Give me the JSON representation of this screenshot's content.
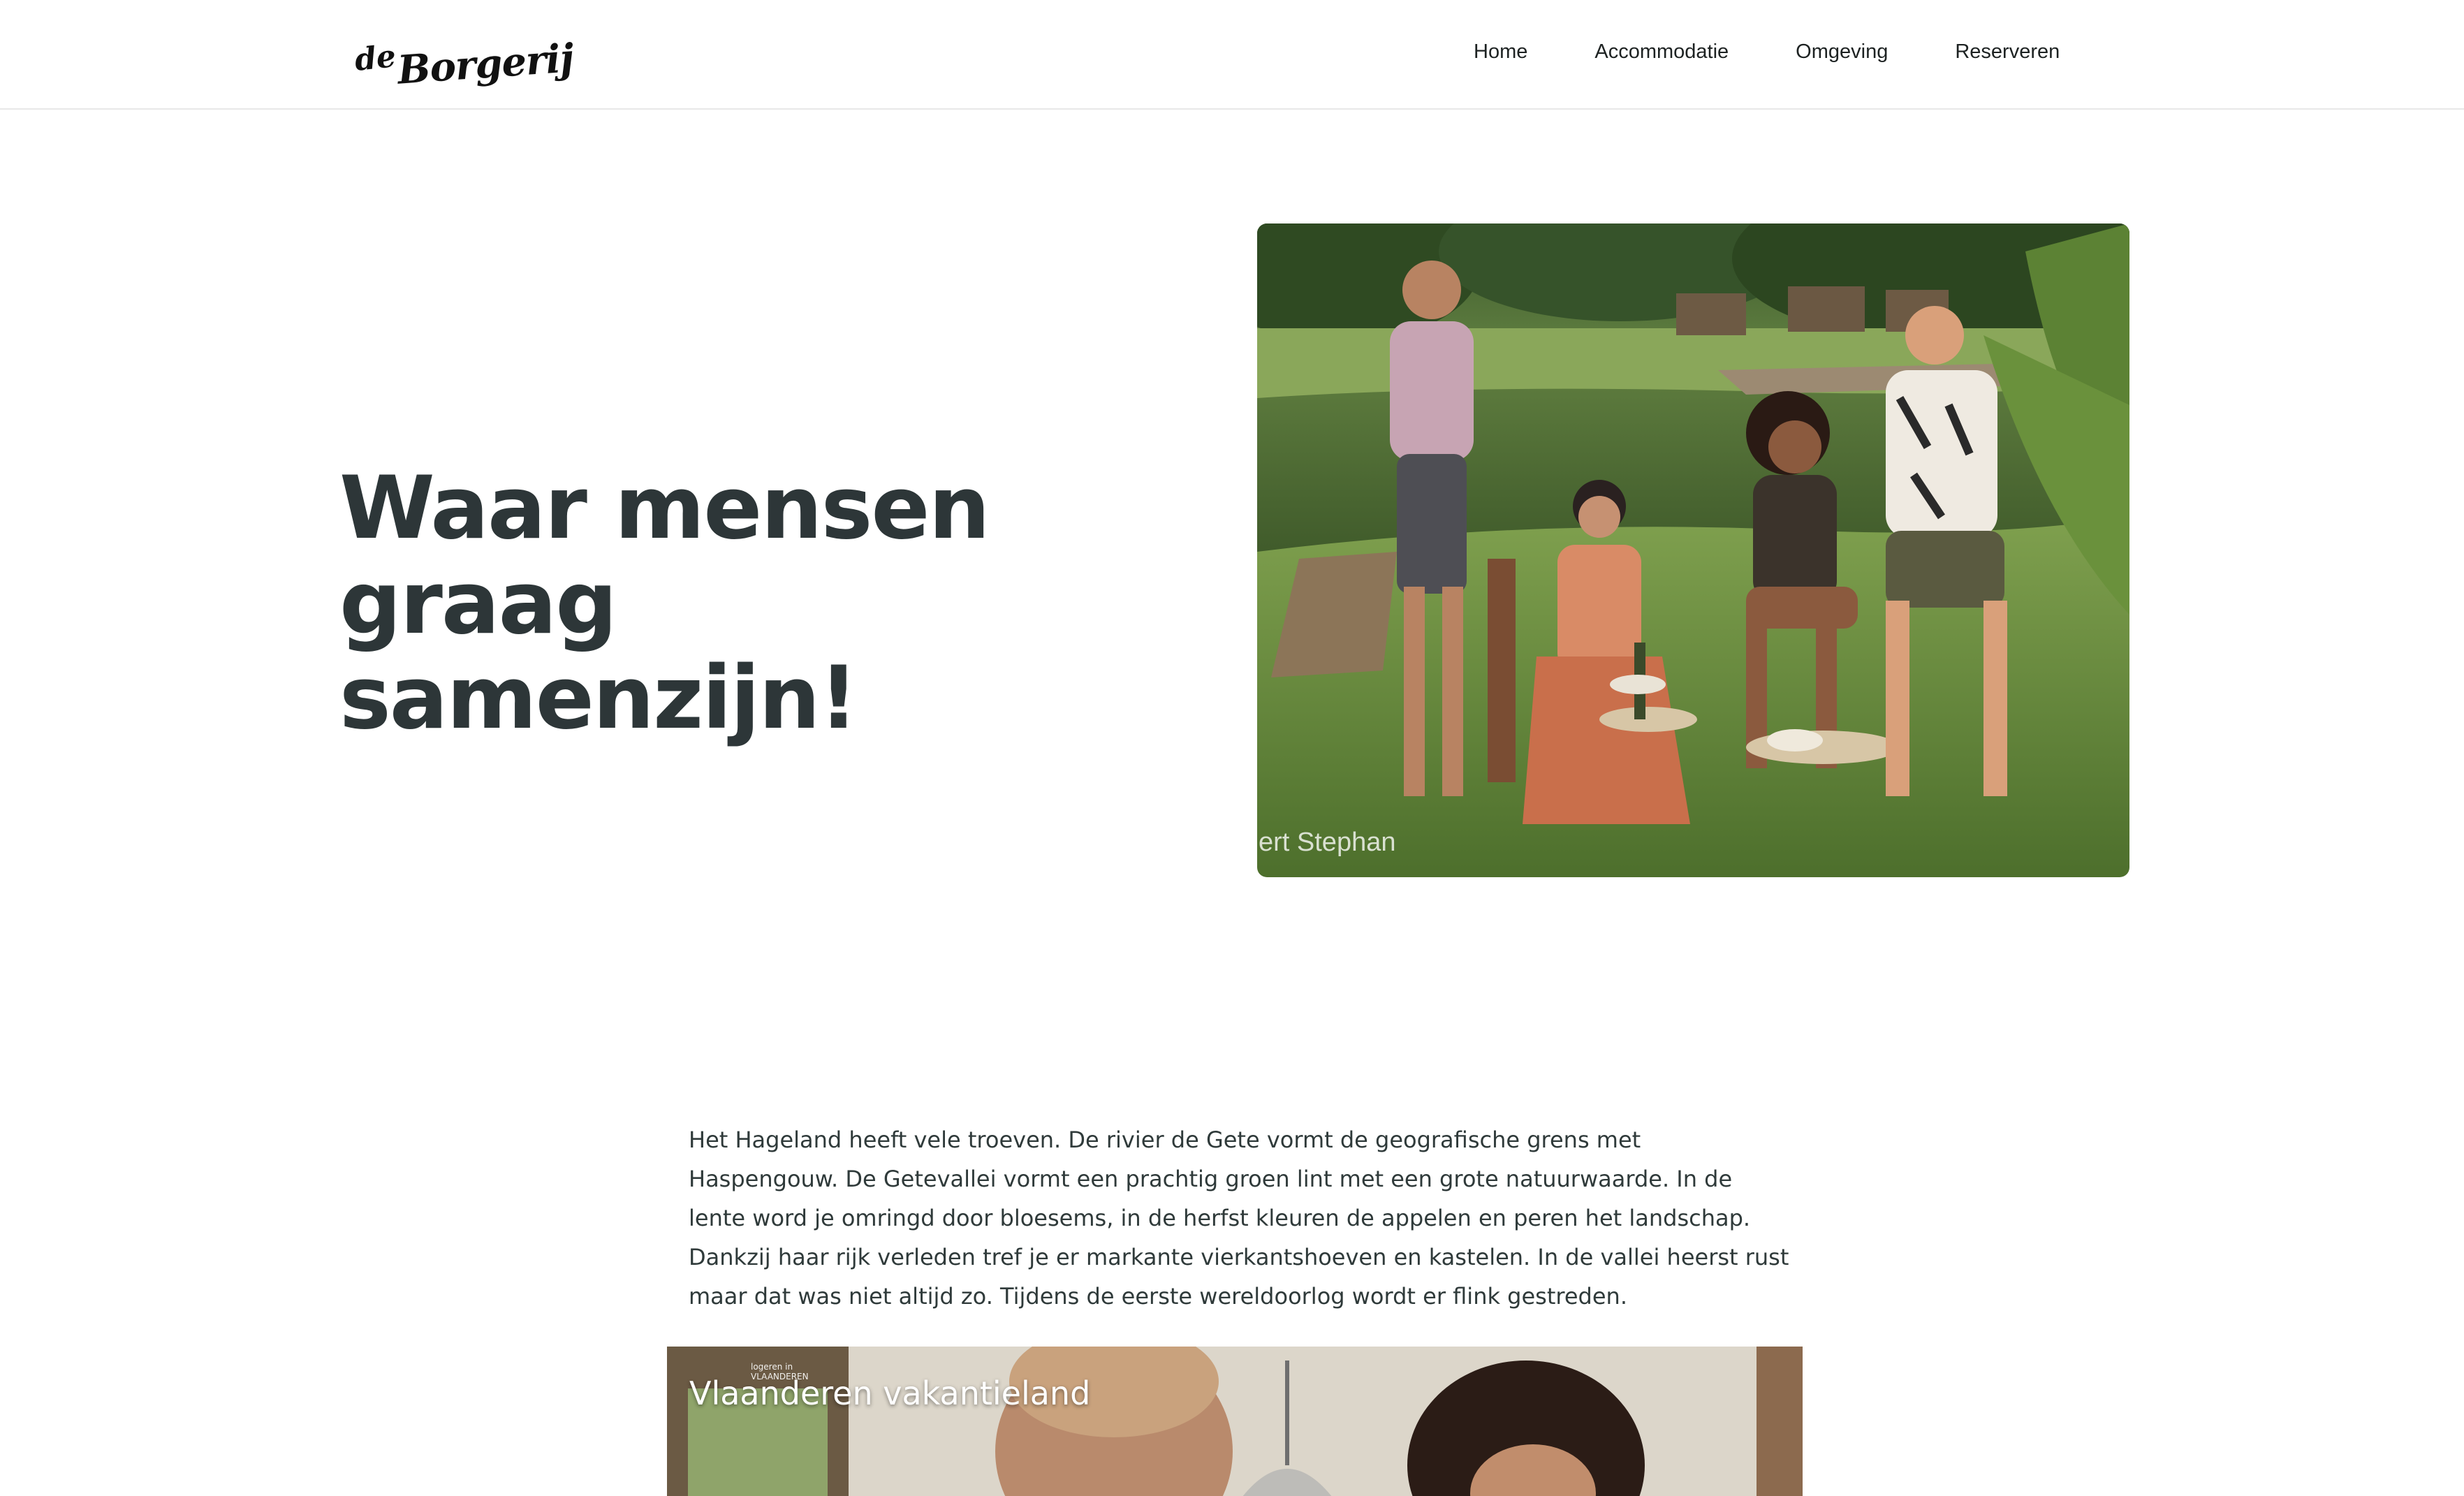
{
  "header": {
    "logo": {
      "prefix": "de",
      "name": "Borgerij"
    },
    "nav": [
      {
        "label": "Home"
      },
      {
        "label": "Accommodatie"
      },
      {
        "label": "Omgeving"
      },
      {
        "label": "Reserveren"
      }
    ]
  },
  "hero": {
    "title_line1": "Waar mensen",
    "title_line2": "graag samenzijn!",
    "image_credit": "ert Stephan"
  },
  "intro": {
    "text": "Het Hageland heeft vele troeven. De rivier de Gete vormt de geografische grens met Haspengouw. De Getevallei vormt een prachtig groen lint met een grote natuurwaarde. In de lente word je omringd door bloesems, in de herfst kleuren de appelen en peren het landschap. Dankzij haar rijk verleden tref je er markante vierkantshoeven en kastelen. In de vallei heerst rust maar dat was niet altijd zo. Tijdens de eerste wereldoorlog wordt er flink gestreden."
  },
  "video": {
    "title": "Vlaanderen vakantieland",
    "badge_line1": "logeren in",
    "badge_line2": "VLAANDEREN"
  },
  "colors": {
    "heading": "#2d3638",
    "text": "#2f3a3a",
    "header_border": "#e8e8e8",
    "background": "#ffffff"
  }
}
